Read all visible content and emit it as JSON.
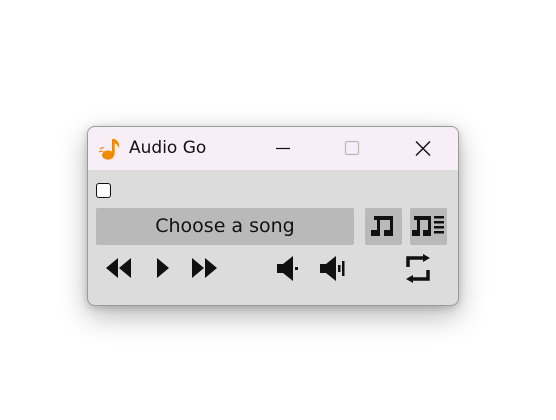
{
  "window": {
    "title": "Audio Go",
    "titlebar_color": "#f8eef8",
    "body_color": "#dcdcdc",
    "app_icon": "music-note-icon",
    "app_icon_color": "#f08a00"
  },
  "titlebar_buttons": [
    "minimize-icon",
    "maximize-icon",
    "close-icon"
  ],
  "controls": {
    "checkbox_checked": false,
    "song_button_label": "Choose a song",
    "button_color": "#b9b9b9",
    "icons": {
      "note": "music-note-icon",
      "playlist": "playlist-icon",
      "rewind": "rewind-icon",
      "play": "play-icon",
      "forward": "fast-forward-icon",
      "volume_down": "volume-down-icon",
      "volume_up": "volume-up-icon",
      "repeat": "repeat-icon"
    }
  }
}
